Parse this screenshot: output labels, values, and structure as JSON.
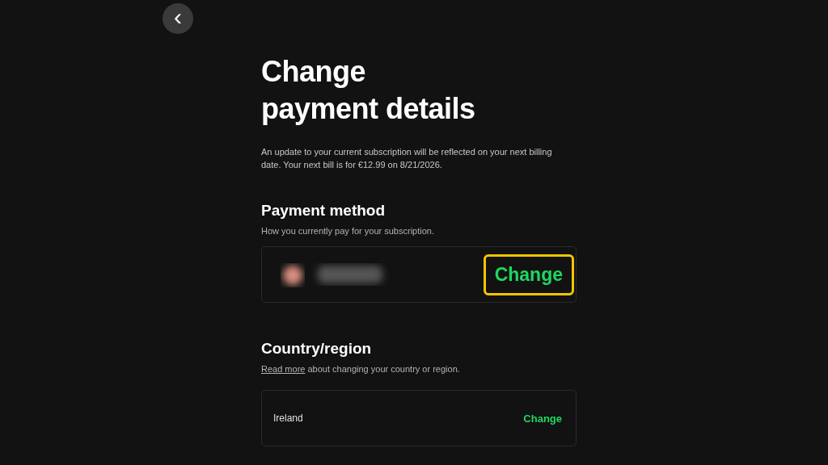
{
  "back_button": {
    "icon": "‹"
  },
  "title_lines": [
    "Change",
    "payment details"
  ],
  "intro": "An update to your current subscription will be reflected on your next billing date. Your next bill is for €12.99 on 8/21/2026.",
  "sections": [
    {
      "kind": "payment",
      "heading": "Payment method",
      "description": "How you currently pay for your subscription.",
      "card": {
        "action": "Change",
        "highlighted": true
      }
    },
    {
      "kind": "country",
      "heading": "Country/region",
      "link": "Read more",
      "description": " about changing your country or region.",
      "card": {
        "value": "Ireland",
        "action": "Change",
        "highlighted": false
      }
    }
  ]
}
